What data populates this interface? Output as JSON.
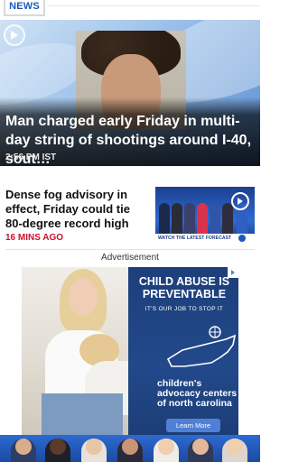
{
  "header": {
    "badge": "NEWS"
  },
  "hero": {
    "title": "Man charged early Friday in multi-day string of shootings around I-40, sout…",
    "time": "2:56 PM IST",
    "play_icon": "play-circle-icon"
  },
  "story": {
    "title": "Dense fog advisory in effect, Friday could tie 80-degree record high",
    "time": "16 MINS AGO",
    "thumb_banner": "WATCH THE LATEST FORECAST",
    "thumb_play_icon": "play-circle-icon"
  },
  "ad": {
    "label": "Advertisement",
    "headline": "CHILD ABUSE IS PREVENTABLE",
    "subline": "IT'S OUR JOB TO STOP IT",
    "org": "children's advocacy centers of north carolina",
    "button": "Learn More",
    "choice_icon": "adchoices-icon"
  },
  "colors": {
    "accent_blue": "#1a5bb8",
    "time_red": "#d10f2b",
    "ad_navy": "#1d3f7a"
  }
}
